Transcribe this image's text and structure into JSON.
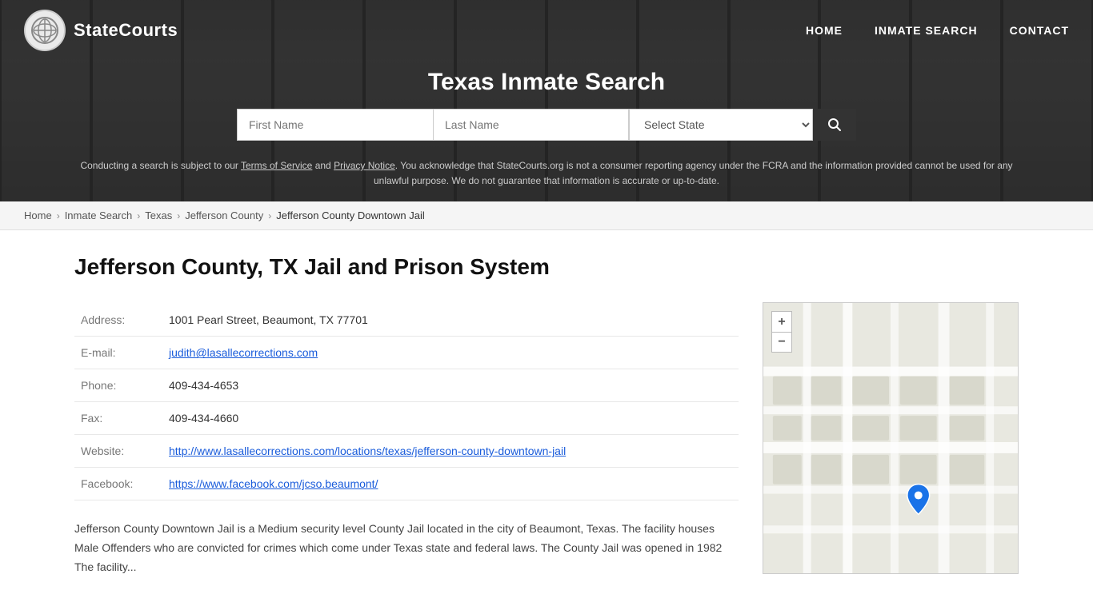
{
  "site": {
    "logo_text": "StateCourts",
    "logo_symbol": "⏣"
  },
  "nav": {
    "links": [
      {
        "id": "home",
        "label": "HOME"
      },
      {
        "id": "inmate-search",
        "label": "INMATE SEARCH"
      },
      {
        "id": "contact",
        "label": "CONTACT"
      }
    ]
  },
  "hero": {
    "title": "Texas Inmate Search",
    "search": {
      "first_name_placeholder": "First Name",
      "last_name_placeholder": "Last Name",
      "state_placeholder": "Select State",
      "search_button_label": "Search"
    }
  },
  "disclaimer": {
    "text_before_tos": "Conducting a search is subject to our ",
    "tos_label": "Terms of Service",
    "text_between": " and ",
    "privacy_label": "Privacy Notice",
    "text_after": ". You acknowledge that StateCourts.org is not a consumer reporting agency under the FCRA and the information provided cannot be used for any unlawful purpose. We do not guarantee that information is accurate or up-to-date."
  },
  "breadcrumb": {
    "items": [
      {
        "id": "home",
        "label": "Home",
        "link": true
      },
      {
        "id": "inmate-search",
        "label": "Inmate Search",
        "link": true
      },
      {
        "id": "texas",
        "label": "Texas",
        "link": true
      },
      {
        "id": "jefferson-county",
        "label": "Jefferson County",
        "link": true
      },
      {
        "id": "current",
        "label": "Jefferson County Downtown Jail",
        "link": false
      }
    ]
  },
  "facility": {
    "heading": "Jefferson County, TX Jail and Prison System",
    "fields": {
      "address_label": "Address:",
      "address_value": "1001 Pearl Street, Beaumont, TX 77701",
      "email_label": "E-mail:",
      "email_value": "judith@lasallecorrections.com",
      "phone_label": "Phone:",
      "phone_value": "409-434-4653",
      "fax_label": "Fax:",
      "fax_value": "409-434-4660",
      "website_label": "Website:",
      "website_value": "http://www.lasallecorrections.com/locations/texas/jefferson-county-downtown-jail",
      "facebook_label": "Facebook:",
      "facebook_value": "https://www.facebook.com/jcso.beaumont/"
    },
    "description": "Jefferson County Downtown Jail is a Medium security level County Jail located in the city of Beaumont, Texas. The facility houses Male Offenders who are convicted for crimes which come under Texas state and federal laws. The County Jail was opened in 1982 The facility..."
  },
  "map": {
    "zoom_in_label": "+",
    "zoom_out_label": "−"
  }
}
